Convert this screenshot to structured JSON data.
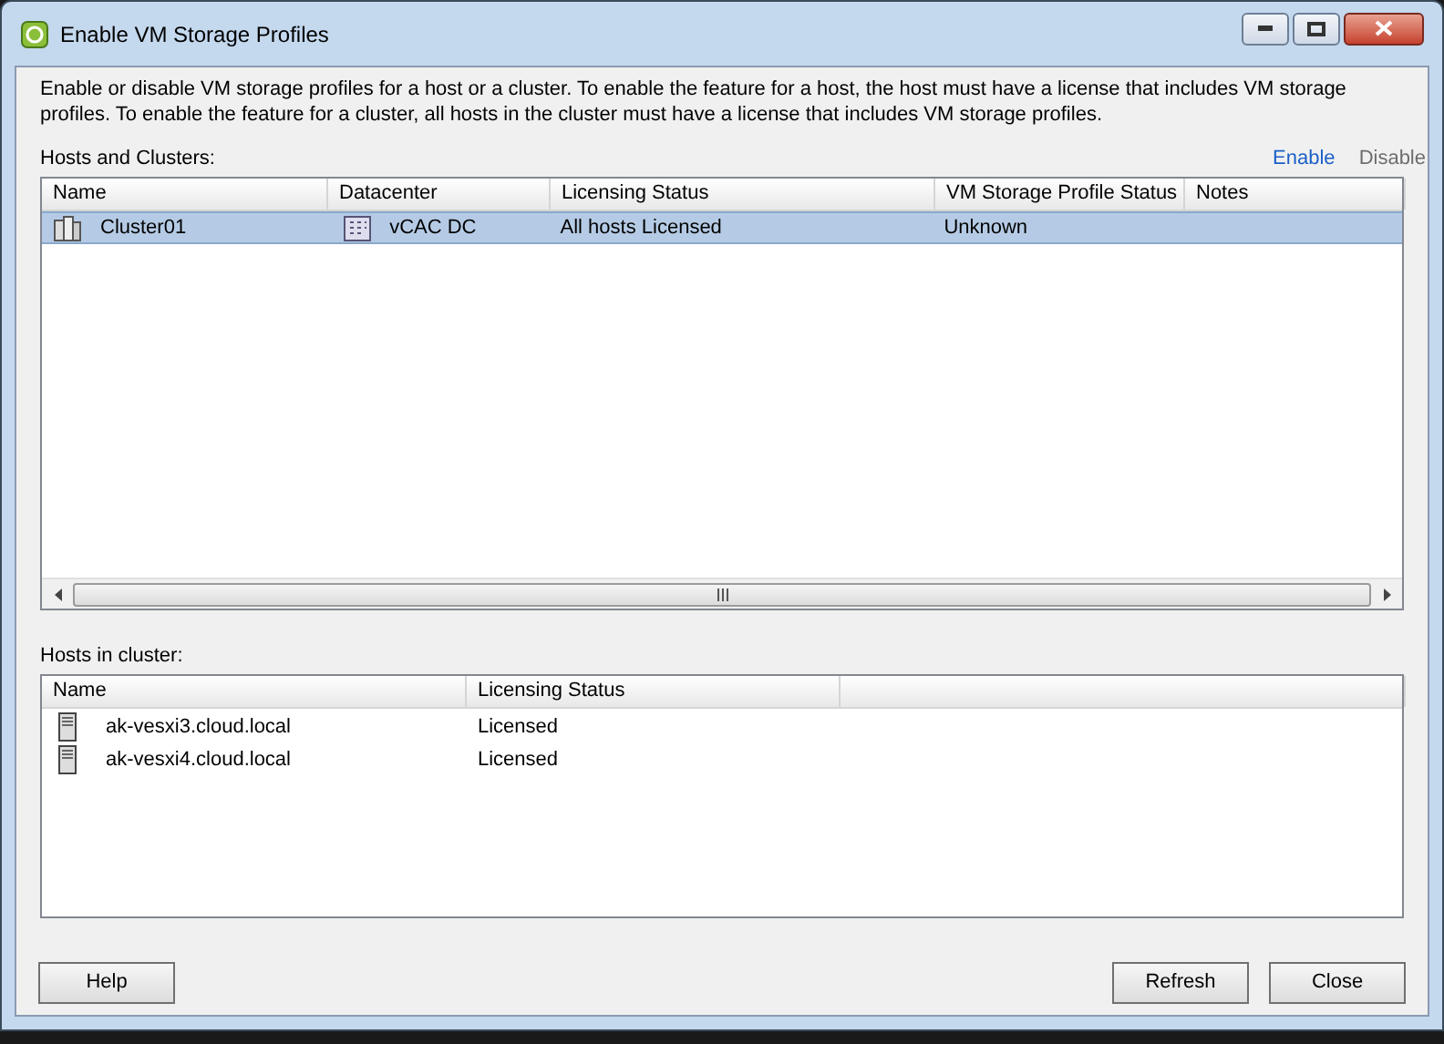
{
  "window": {
    "title": "Enable VM Storage Profiles"
  },
  "description": "Enable or disable VM storage profiles for a host or a cluster. To enable the feature for a host, the host must have a license that includes VM storage profiles. To enable the feature for a cluster, all hosts in the cluster must have a license that includes VM storage profiles.",
  "hosts_and_clusters": {
    "label": "Hosts and Clusters:",
    "actions": [
      {
        "label": "Enable",
        "disabled": false
      },
      {
        "label": "Disable",
        "disabled": true
      }
    ],
    "columns": [
      "Name",
      "Datacenter",
      "Licensing Status",
      "VM Storage Profile Status",
      "Notes"
    ],
    "rows": [
      {
        "name": "Cluster01",
        "datacenter": "vCAC DC",
        "licensing_status": "All hosts Licensed",
        "vm_storage_profile_status": "Unknown",
        "notes": "",
        "selected": true
      }
    ]
  },
  "hosts_in_cluster": {
    "label": "Hosts in cluster:",
    "columns": [
      "Name",
      "Licensing Status"
    ],
    "rows": [
      {
        "name": "ak-vesxi3.cloud.local",
        "licensing_status": "Licensed",
        "selected": false
      },
      {
        "name": "ak-vesxi4.cloud.local",
        "licensing_status": "Licensed",
        "selected": false
      }
    ]
  },
  "buttons": {
    "left": [
      "Help"
    ],
    "right": [
      "Refresh",
      "Close"
    ]
  }
}
